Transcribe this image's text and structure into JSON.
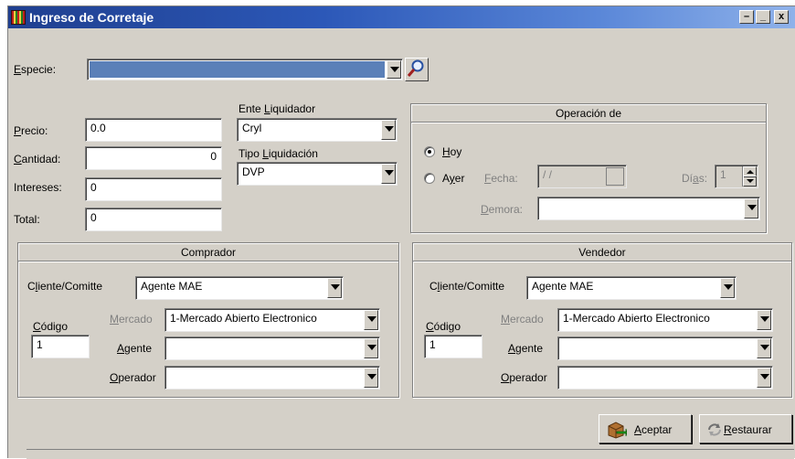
{
  "window": {
    "title": "Ingreso de Corretaje",
    "controls": {
      "restore": "–",
      "minimize": "_",
      "close": "x"
    }
  },
  "especie": {
    "label_u": "E",
    "label_rest": "specie:",
    "value": ""
  },
  "precio": {
    "label_u": "P",
    "label_rest": "recio:",
    "value": "0.0"
  },
  "cantidad": {
    "label_u": "C",
    "label_rest": "antidad:",
    "value": "0"
  },
  "intereses": {
    "label": "Intereses:",
    "value": "0"
  },
  "total": {
    "label": "Total:",
    "value": "0"
  },
  "ente_liquidador": {
    "label_pre": "Ente ",
    "label_u": "L",
    "label_rest": "iquidador",
    "value": "Cryl"
  },
  "tipo_liquidacion": {
    "label_pre": "Tipo ",
    "label_u": "L",
    "label_rest": "iquidación",
    "value": "DVP"
  },
  "operacion": {
    "title": "Operación de",
    "hoy": {
      "label_u": "H",
      "label_rest": "oy",
      "selected": true
    },
    "ayer": {
      "label_pre": "A",
      "label_u": "y",
      "label_rest": "er",
      "selected": false
    },
    "fecha": {
      "label_u": "F",
      "label_rest": "echa:",
      "value": " / /"
    },
    "dias": {
      "label_pre": "Dí",
      "label_u": "a",
      "label_rest": "s:",
      "value": "1"
    },
    "demora": {
      "label_u": "D",
      "label_rest": "emora:",
      "value": ""
    }
  },
  "comprador": {
    "title": "Comprador",
    "cliente": {
      "label_pre": "C",
      "label_u": "l",
      "label_rest": "iente/Comitte",
      "value": "Agente MAE"
    },
    "codigo": {
      "label_u": "C",
      "label_rest": "ódigo",
      "value": "1"
    },
    "mercado": {
      "label_u": "M",
      "label_rest": "ercado",
      "value": "1-Mercado Abierto Electronico"
    },
    "agente": {
      "label_u": "A",
      "label_rest": "gente",
      "value": ""
    },
    "operador": {
      "label_u": "O",
      "label_rest": "perador",
      "value": ""
    }
  },
  "vendedor": {
    "title": "Vendedor",
    "cliente": {
      "label_pre": "C",
      "label_u": "l",
      "label_rest": "iente/Comitte",
      "value": "Agente MAE"
    },
    "codigo": {
      "label_u": "C",
      "label_rest": "ódigo",
      "value": "1"
    },
    "mercado": {
      "label_u": "M",
      "label_rest": "ercado",
      "value": "1-Mercado Abierto Electronico"
    },
    "agente": {
      "label_u": "A",
      "label_rest": "gente",
      "value": ""
    },
    "operador": {
      "label_u": "O",
      "label_rest": "perador",
      "value": ""
    }
  },
  "buttons": {
    "aceptar": {
      "label_u": "A",
      "label_rest": "ceptar"
    },
    "restaurar": {
      "label_u": "R",
      "label_rest": "estaurar"
    }
  },
  "colors": {
    "titlebar_start": "#1f3f8f",
    "titlebar_end": "#8fb2ea",
    "especie_selection": "#5b80b8",
    "window_face": "#d4d0c8"
  },
  "icons": {
    "app": "app-grid-icon",
    "search": "magnifier-icon",
    "aceptar": "accept-box-icon",
    "restaurar": "restore-arrows-icon"
  }
}
